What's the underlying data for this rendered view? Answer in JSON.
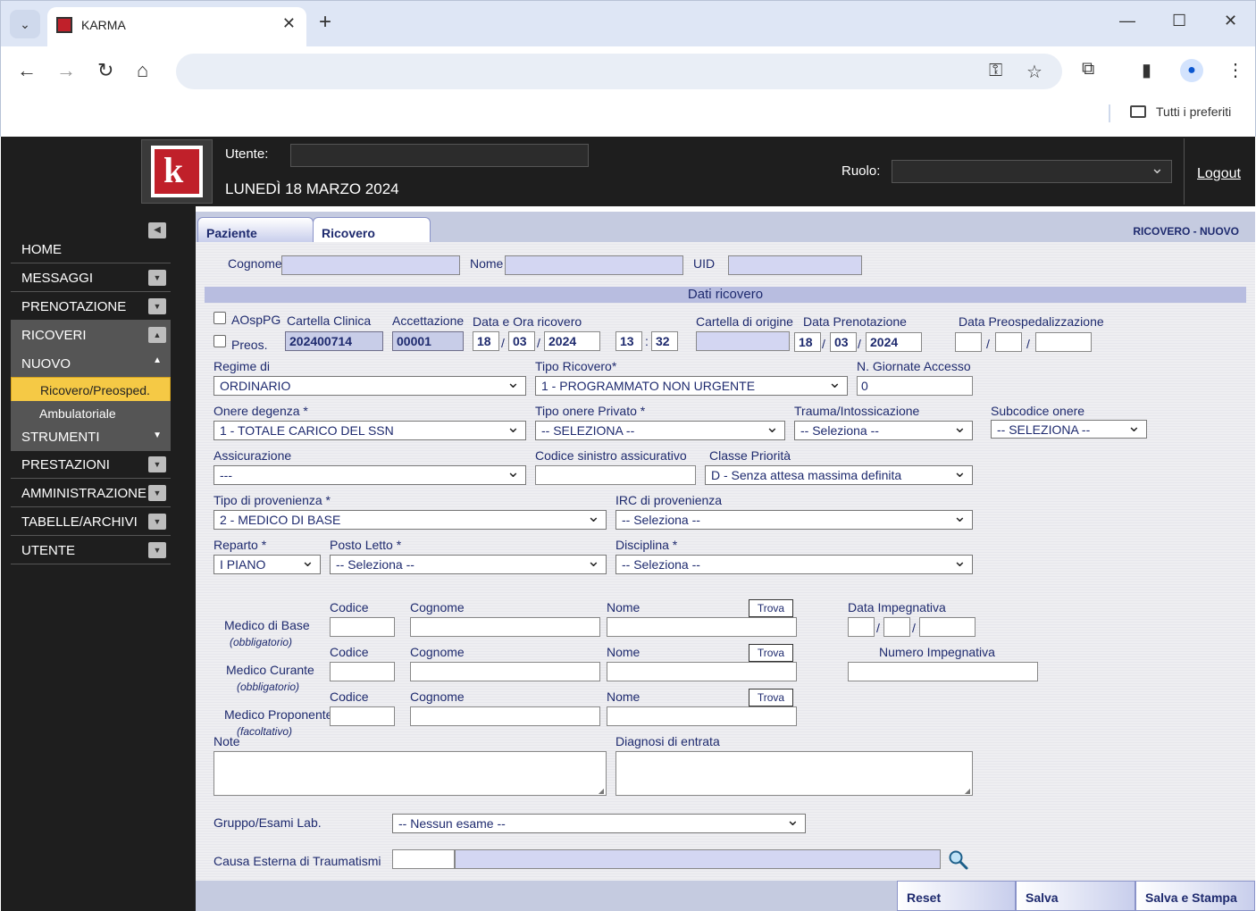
{
  "browser": {
    "tab_title": "KARMA",
    "bookmarks_label": "Tutti i preferiti"
  },
  "header": {
    "utente_label": "Utente:",
    "utente_value": "",
    "date": "LUNEDÌ 18 MARZO 2024",
    "ruolo_label": "Ruolo:",
    "ruolo_value": "",
    "logout": "Logout"
  },
  "sidebar": {
    "items": [
      {
        "label": "HOME"
      },
      {
        "label": "MESSAGGI"
      },
      {
        "label": "PRENOTAZIONE"
      },
      {
        "label": "RICOVERI"
      },
      {
        "label": "NUOVO"
      },
      {
        "label": "STRUMENTI"
      },
      {
        "label": "PRESTAZIONI"
      },
      {
        "label": "AMMINISTRAZIONE"
      },
      {
        "label": "TABELLE/ARCHIVI"
      },
      {
        "label": "UTENTE"
      }
    ],
    "sub_items": [
      {
        "label": "Ricovero/Preosped."
      },
      {
        "label": "Ambulatoriale"
      }
    ]
  },
  "tabs": {
    "paziente": "Paziente",
    "ricovero": "Ricovero",
    "mode": "RICOVERO  -  NUOVO"
  },
  "patient": {
    "cognome_label": "Cognome",
    "nome_label": "Nome",
    "uid_label": "UID",
    "cognome": "",
    "nome": "",
    "uid": ""
  },
  "section_title": "Dati ricovero",
  "ricovero": {
    "aospg_label": "AOspPG",
    "preos_label": "Preos.",
    "cartella_clinica_label": "Cartella Clinica",
    "cartella_clinica": "202400714",
    "accettazione_label": "Accettazione",
    "accettazione": "00001",
    "data_ora_label": "Data e Ora ricovero",
    "data_day": "18",
    "data_month": "03",
    "data_year": "2024",
    "ora_h": "13",
    "ora_m": "32",
    "cartella_origine_label": "Cartella di origine",
    "cartella_origine": "",
    "data_prenotazione_label": "Data Prenotazione",
    "pren_day": "18",
    "pren_month": "03",
    "pren_year": "2024",
    "data_preosped_label": "Data Preospedalizzazione",
    "regime_label": "Regime di",
    "regime": "ORDINARIO",
    "tipo_ricovero_label": "Tipo Ricovero*",
    "tipo_ricovero": "1 - PROGRAMMATO NON URGENTE",
    "giornate_label": "N. Giornate Accesso",
    "giornate": "0",
    "onere_label": "Onere degenza *",
    "onere": "1 - TOTALE CARICO DEL SSN",
    "onere_privato_label": "Tipo onere Privato *",
    "onere_privato": "-- SELEZIONA --",
    "trauma_label": "Trauma/Intossicazione",
    "trauma": "-- Seleziona --",
    "subcodice_label": "Subcodice onere",
    "subcodice": "-- SELEZIONA --",
    "assicurazione_label": "Assicurazione",
    "assicurazione": "---",
    "sinistro_label": "Codice sinistro assicurativo",
    "classe_label": "Classe Priorità",
    "classe": "D - Senza attesa massima definita",
    "provenienza_label": "Tipo di provenienza *",
    "provenienza": "2 - MEDICO DI BASE",
    "irc_label": "IRC di provenienza",
    "irc": "-- Seleziona --",
    "reparto_label": "Reparto *",
    "reparto": "I PIANO",
    "posto_letto_label": "Posto Letto *",
    "posto_letto": "-- Seleziona --",
    "disciplina_label": "Disciplina *",
    "disciplina": "-- Seleziona --"
  },
  "medici": {
    "codice_label": "Codice",
    "cognome_label": "Cognome",
    "nome_label": "Nome",
    "trova": "Trova",
    "base_label": "Medico di Base",
    "base_note": "(obbligatorio)",
    "curante_label": "Medico Curante",
    "curante_note": "(obbligatorio)",
    "proponente_label": "Medico Proponente",
    "proponente_note": "(facoltativo)",
    "data_impegnativa_label": "Data Impegnativa",
    "numero_impegnativa_label": "Numero Impegnativa"
  },
  "note_label": "Note",
  "diagnosi_label": "Diagnosi di entrata",
  "gruppo_label": "Gruppo/Esami Lab.",
  "gruppo": "-- Nessun esame --",
  "causa_label": "Causa Esterna di Traumatismi",
  "footer": {
    "reset": "Reset",
    "salva": "Salva",
    "salva_stampa": "Salva e Stampa"
  }
}
